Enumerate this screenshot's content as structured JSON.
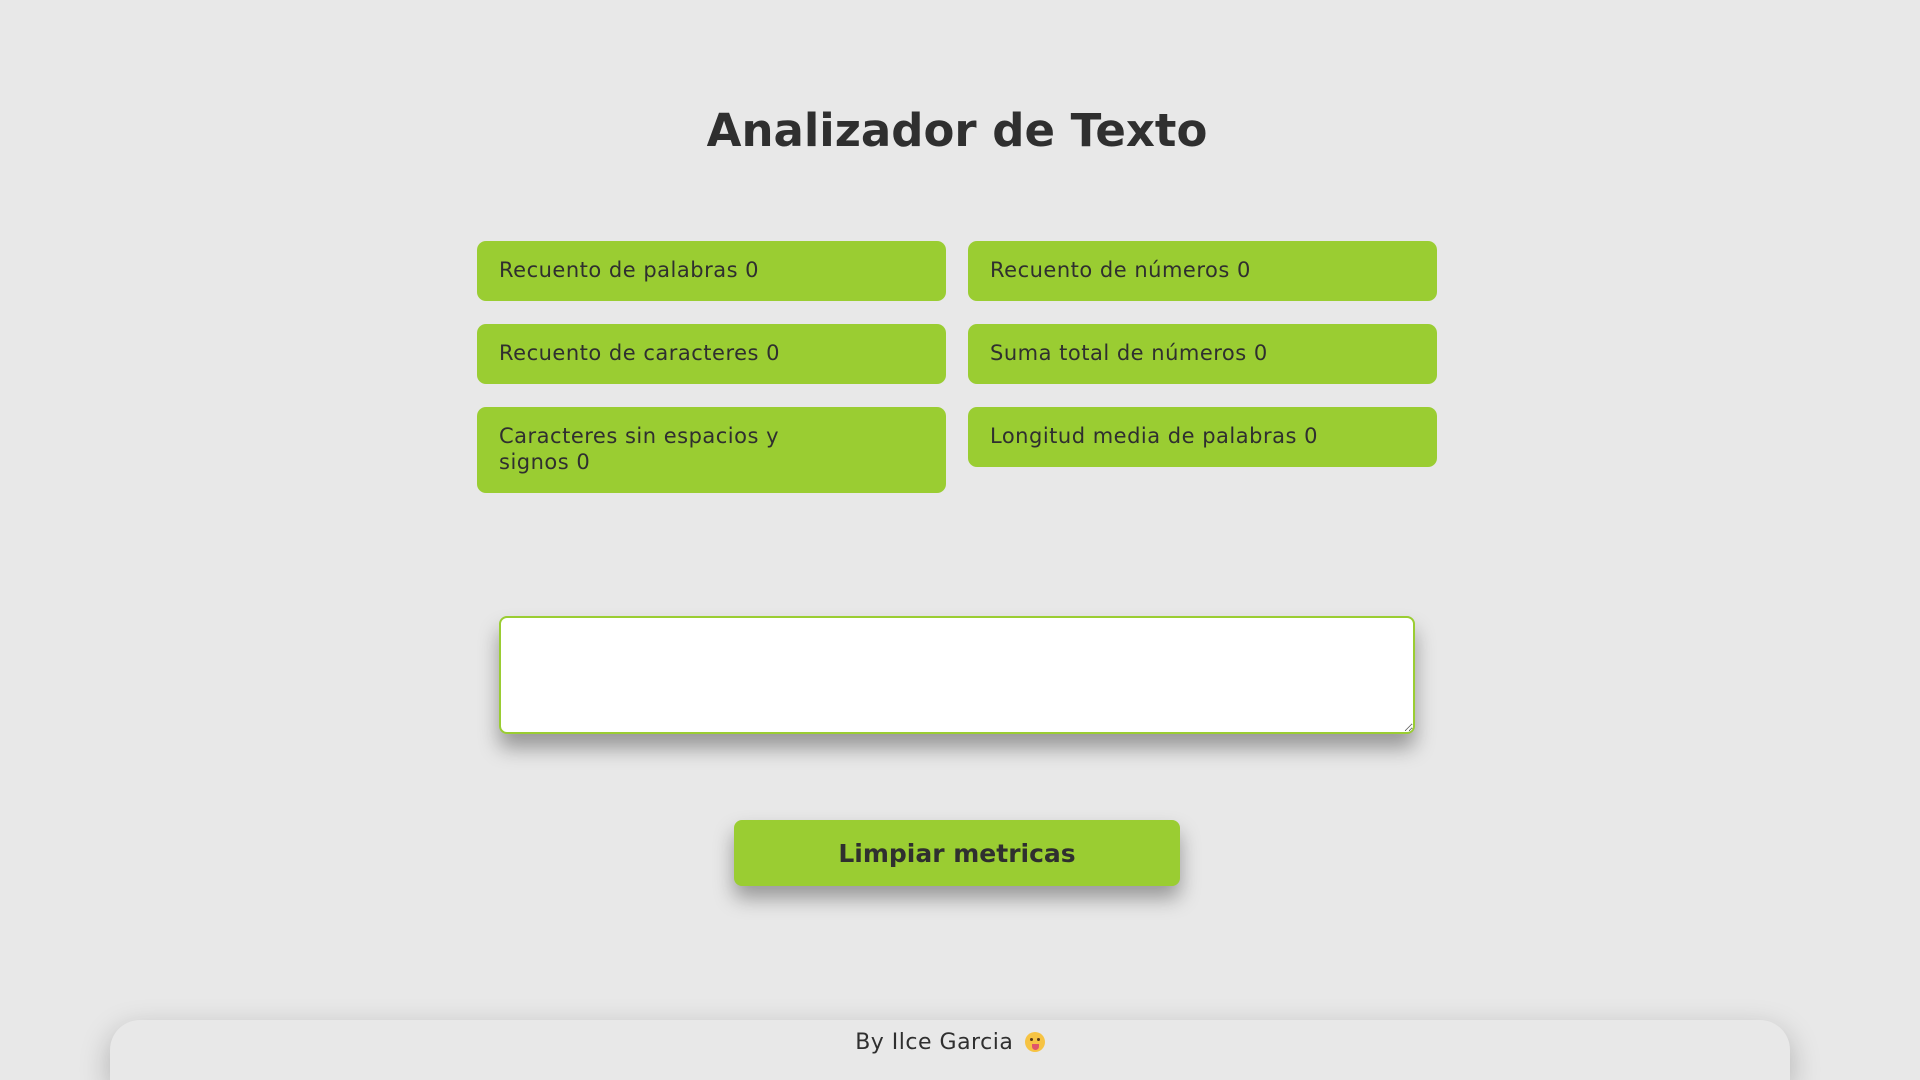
{
  "header": {
    "title": "Analizador de Texto"
  },
  "metrics": {
    "words": "Recuento de palabras 0",
    "numbers": "Recuento de números 0",
    "characters": "Recuento de caracteres 0",
    "numbers_sum": "Suma total de números 0",
    "chars_no_spaces": "Caracteres sin espacios y signos 0",
    "avg_word_length": "Longitud media de palabras 0"
  },
  "input": {
    "value": "",
    "placeholder": ""
  },
  "actions": {
    "clear_label": "Limpiar metricas"
  },
  "footer": {
    "text": "By Ilce Garcia",
    "emoji_icon": "tongue-out-face-icon"
  },
  "colors": {
    "accent": "#9acd32",
    "background": "#e8e8e8",
    "text": "#2f2f2f"
  }
}
